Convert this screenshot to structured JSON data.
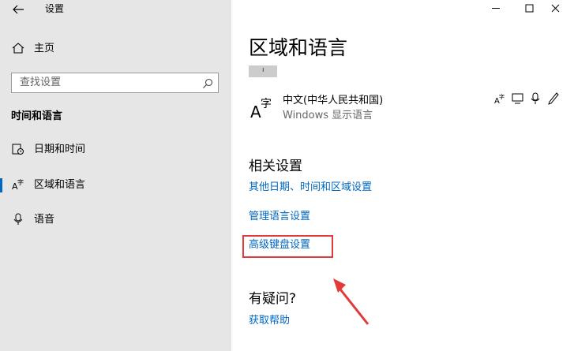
{
  "window": {
    "title": "设置",
    "controls": [
      "minimize-icon",
      "maximize-icon",
      "close-icon"
    ]
  },
  "sidebar": {
    "home_label": "主页",
    "search_placeholder": "查找设置",
    "section_header": "时间和语言",
    "items": [
      {
        "label": "日期和时间",
        "icon": "calendar-clock-icon",
        "selected": false
      },
      {
        "label": "区域和语言",
        "icon": "language-icon",
        "selected": true
      },
      {
        "label": "语音",
        "icon": "microphone-icon",
        "selected": false
      }
    ]
  },
  "main": {
    "title": "区域和语言",
    "language": {
      "name": "中文(中华人民共和国)",
      "sub": "Windows 显示语言",
      "icon": "language-icon",
      "feature_icons": [
        "language-pack-icon",
        "handwriting-icon",
        "speech-icon",
        "pen-icon"
      ]
    },
    "related_header": "相关设置",
    "related_links": [
      "其他日期、时间和区域设置",
      "管理语言设置",
      "高级键盘设置"
    ],
    "help_header": "有疑问?",
    "help_link": "获取帮助"
  },
  "annotation": {
    "highlight_color": "#e23a3a",
    "highlighted_item": "高级键盘设置"
  },
  "colors": {
    "accent": "#0067c0",
    "sidebar_bg": "#e6e6e6",
    "annotation": "#e23a3a"
  }
}
